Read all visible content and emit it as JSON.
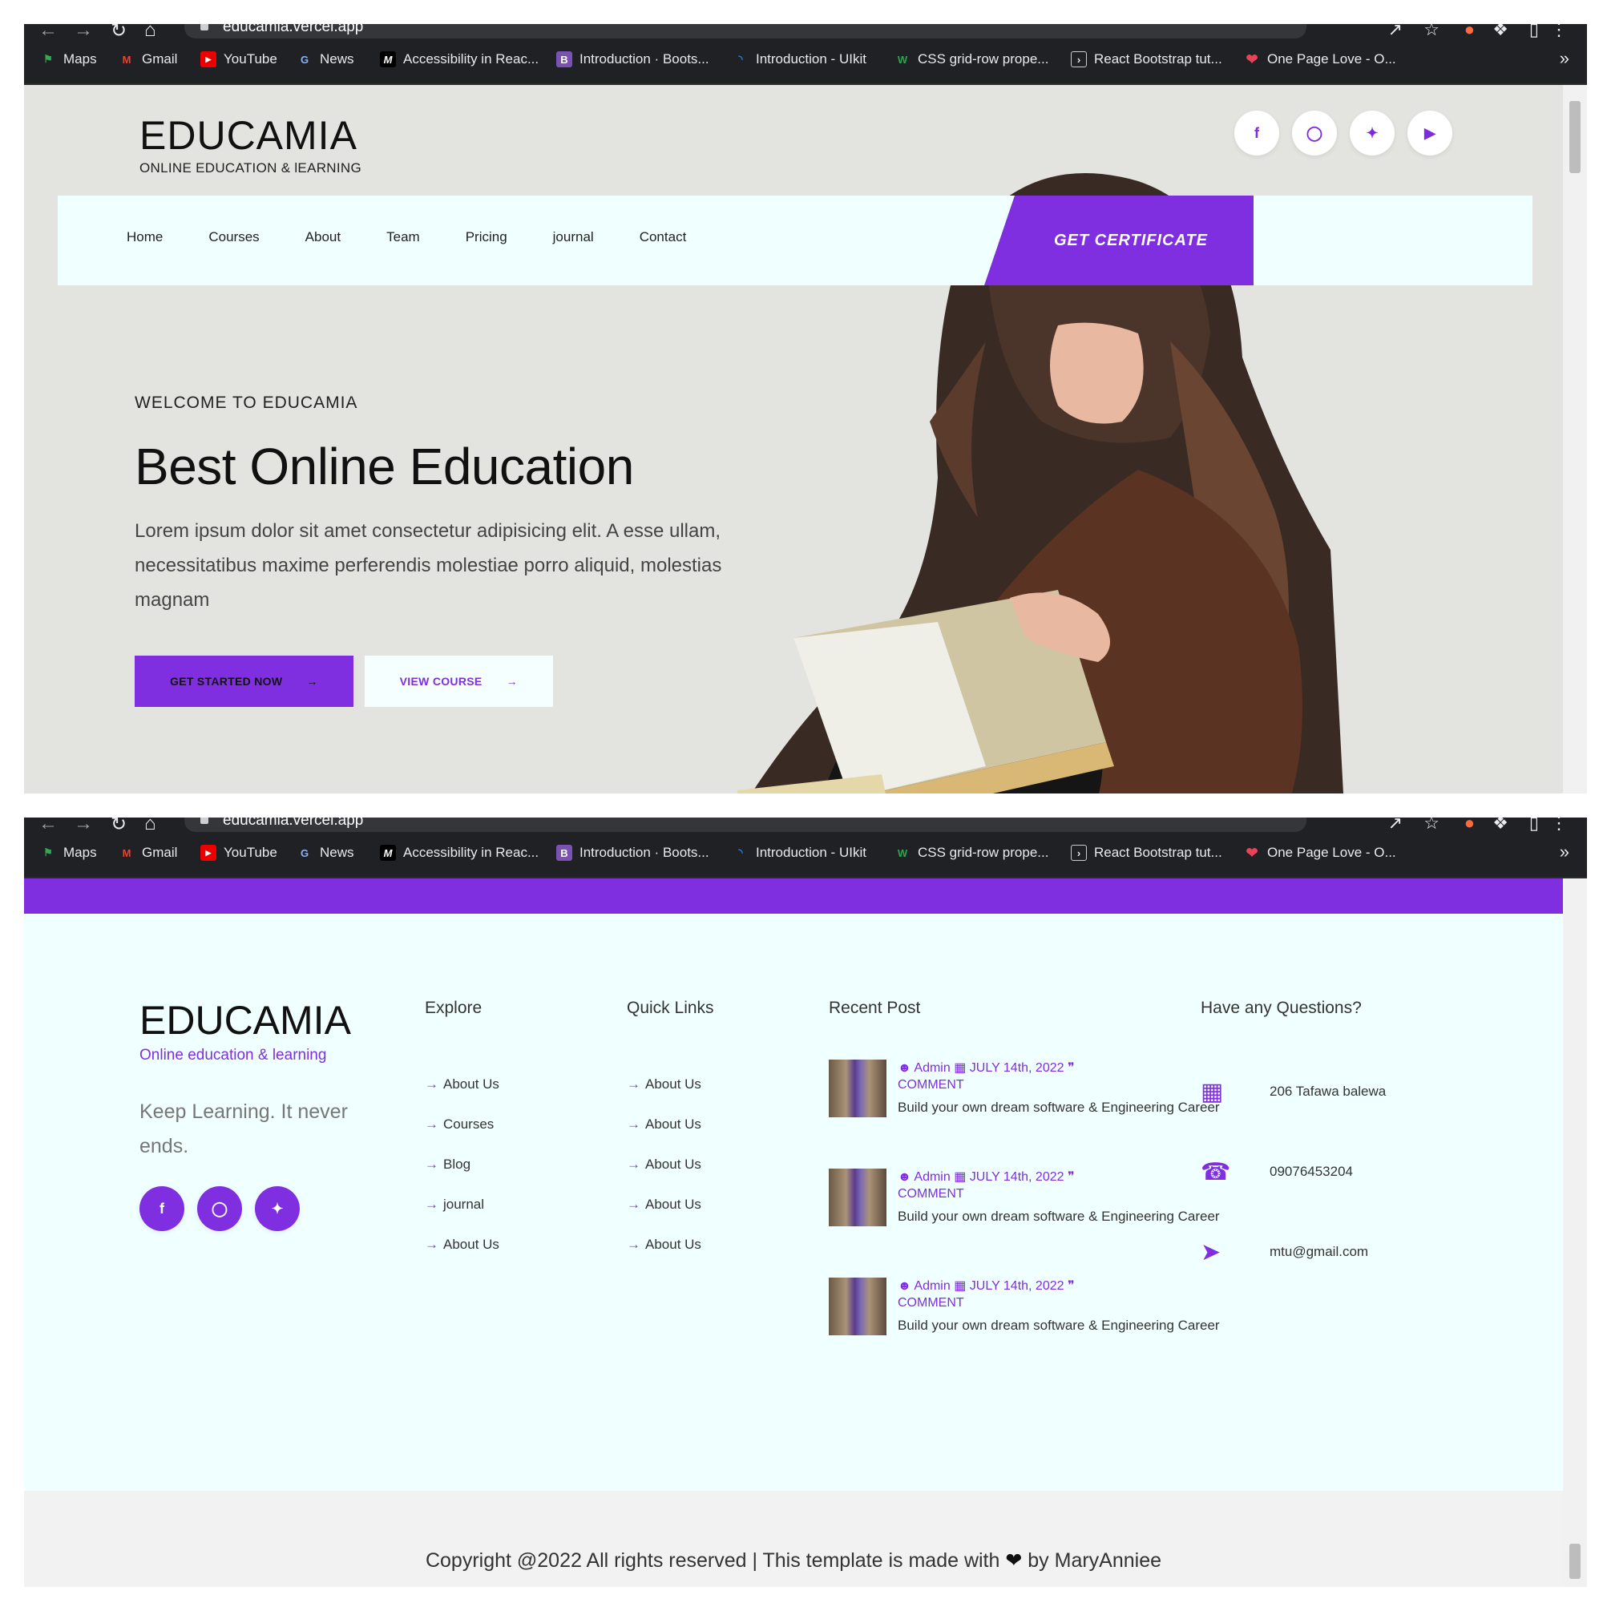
{
  "browser": {
    "url": "educamia.vercel.app",
    "bookmarks": [
      "Maps",
      "Gmail",
      "YouTube",
      "News",
      "Accessibility in Reac...",
      "Introduction · Boots...",
      "Introduction - UIkit",
      "CSS grid-row prope...",
      "React Bootstrap tut...",
      "One Page Love - O..."
    ],
    "more": "»"
  },
  "header": {
    "brand": "EDUCAMIA",
    "tagline": "ONLINE EDUCATION & lEARNING",
    "socials": [
      "facebook-icon",
      "instagram-icon",
      "twitter-icon",
      "youtube-icon"
    ]
  },
  "nav": {
    "items": [
      "Home",
      "Courses",
      "About",
      "Team",
      "Pricing",
      "journal",
      "Contact"
    ],
    "cta": "GET CERTIFICATE"
  },
  "hero": {
    "welcome": "WELCOME TO EDUCAMIA",
    "title": "Best Online Education",
    "lead": "Lorem ipsum dolor sit amet consectetur adipisicing elit. A esse ullam, necessitatibus maxime perferendis molestiae porro aliquid, molestias magnam",
    "primary_btn": "GET STARTED NOW",
    "secondary_btn": "VIEW COURSE"
  },
  "footer": {
    "brand": "EDUCAMIA",
    "tagline": "Online education & learning",
    "slogan": "Keep Learning. It never ends.",
    "explore": {
      "title": "Explore",
      "links": [
        "About Us",
        "Courses",
        "Blog",
        "journal",
        "About Us"
      ]
    },
    "quick_links": {
      "title": "Quick Links",
      "links": [
        "About Us",
        "About Us",
        "About Us",
        "About Us",
        "About Us"
      ]
    },
    "recent_post": {
      "title": "Recent Post",
      "posts": [
        {
          "author": "Admin",
          "date": "JULY 14th, 2022",
          "comment": "COMMENT",
          "title": "Build your own dream software & Engineering Career"
        },
        {
          "author": "Admin",
          "date": "JULY 14th, 2022",
          "comment": "COMMENT",
          "title": "Build your own dream software & Engineering Career"
        },
        {
          "author": "Admin",
          "date": "JULY 14th, 2022",
          "comment": "COMMENT",
          "title": "Build your own dream software & Engineering Career"
        }
      ]
    },
    "questions": {
      "title": "Have any Questions?",
      "address": "206 Tafawa balewa",
      "phone": "09076453204",
      "email": "mtu@gmail.com"
    },
    "copyright_pre": "Copyright @2022 All rights reserved | This template is made with",
    "copyright_post": "by MaryAnniee"
  },
  "colors": {
    "accent": "#7f2fe0",
    "hero_bg": "#e3e3df",
    "nav_bg": "#f0ffff",
    "footer_bg": "#f0ffff"
  }
}
